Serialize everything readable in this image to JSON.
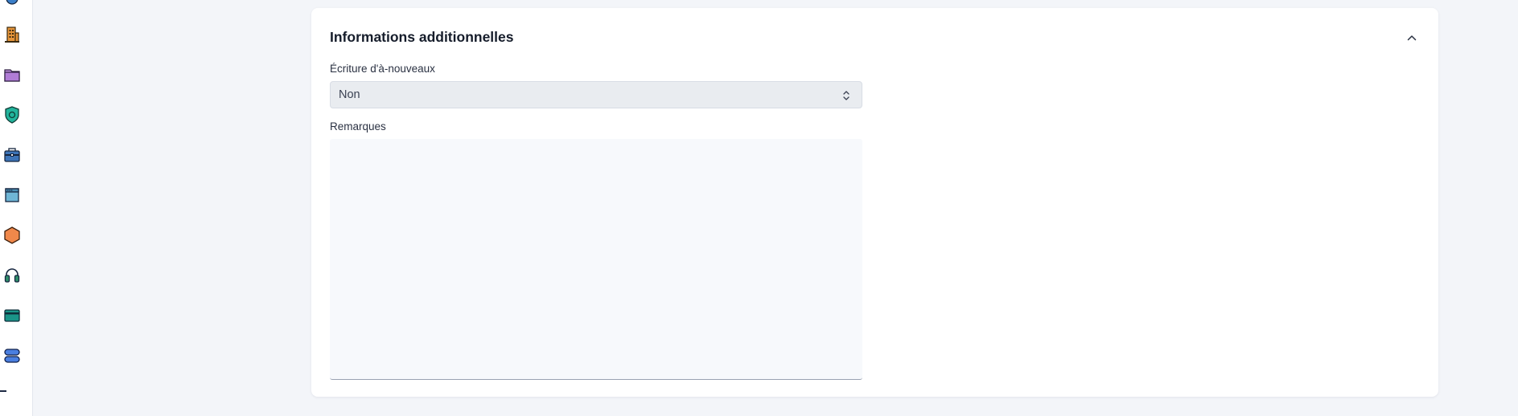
{
  "sidebar": {
    "icons": [
      {
        "name": "circle-icon",
        "color": "#2b6cb0"
      },
      {
        "name": "building-icon",
        "color": "#d9822b"
      },
      {
        "name": "folder-icon",
        "color": "#b07cd6"
      },
      {
        "name": "shield-icon",
        "color": "#1a9e8a"
      },
      {
        "name": "briefcase-icon",
        "color": "#2e5f9e"
      },
      {
        "name": "window-icon",
        "color": "#5fa6c9"
      },
      {
        "name": "hexagon-icon",
        "color": "#f0884a"
      },
      {
        "name": "headset-icon",
        "color": "#2f8f6b"
      },
      {
        "name": "card-icon",
        "color": "#1a9488"
      },
      {
        "name": "database-icon",
        "color": "#3b6fd4"
      }
    ]
  },
  "section": {
    "title": "Informations additionnelles",
    "collapse_icon": "chevron-up-icon"
  },
  "fields": {
    "opening_entry": {
      "label": "Écriture d'à-nouveaux",
      "value": "Non"
    },
    "remarks": {
      "label": "Remarques",
      "value": ""
    }
  },
  "colors": {
    "page_background": "#f3f5f9",
    "card_background": "#ffffff",
    "select_background": "#e9ecf0",
    "textarea_background": "#f7f9fc"
  }
}
